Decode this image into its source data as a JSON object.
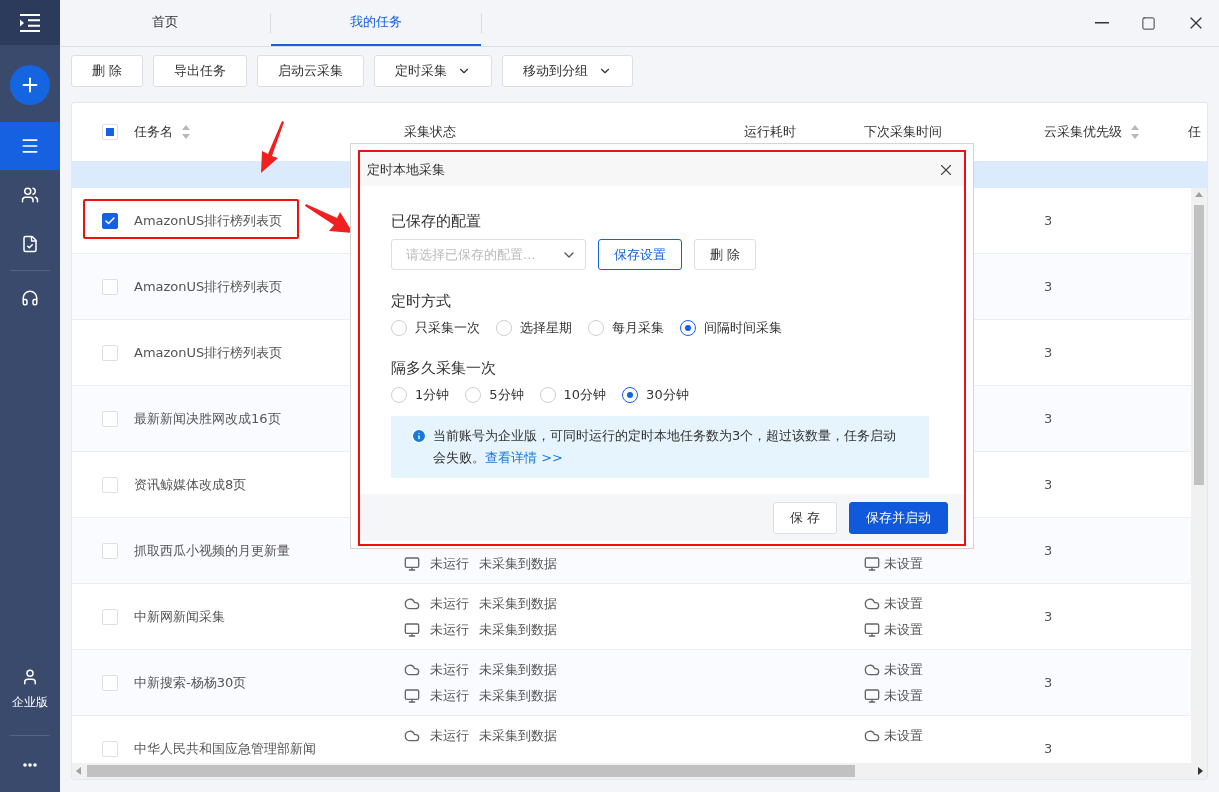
{
  "sidebar": {
    "items": [
      {
        "kind": "list",
        "selected": true
      },
      {
        "kind": "users",
        "selected": false
      },
      {
        "kind": "document",
        "selected": false
      },
      {
        "kind": "headset",
        "selected": false
      }
    ],
    "edition_label": "企业版"
  },
  "tabs": [
    {
      "label": "首页",
      "selected": false
    },
    {
      "label": "我的任务",
      "selected": true
    }
  ],
  "toolbar": [
    {
      "label": "删 除",
      "dropdown": false
    },
    {
      "label": "导出任务",
      "dropdown": false
    },
    {
      "label": "启动云采集",
      "dropdown": false
    },
    {
      "label": "定时采集",
      "dropdown": true
    },
    {
      "label": "移动到分组",
      "dropdown": true
    }
  ],
  "table": {
    "header_indeterminate": true,
    "columns": [
      {
        "label": "任务名",
        "sortable": true
      },
      {
        "label": "采集状态",
        "sortable": false
      },
      {
        "label": "运行耗时",
        "sortable": false
      },
      {
        "label": "下次采集时间",
        "sortable": false
      },
      {
        "label": "云采集优先级",
        "sortable": true
      },
      {
        "label": "任",
        "sortable": false
      }
    ],
    "rows": [
      {
        "name": "AmazonUS排行榜列表页",
        "checked": true,
        "status": [],
        "next_run": [],
        "priority": "3"
      },
      {
        "name": "AmazonUS排行榜列表页",
        "checked": false,
        "status": [],
        "next_run": [],
        "priority": "3"
      },
      {
        "name": "AmazonUS排行榜列表页",
        "checked": false,
        "status": [],
        "next_run": [],
        "priority": "3"
      },
      {
        "name": "最新新闻决胜网改成16页",
        "checked": false,
        "status": [],
        "next_run": [],
        "priority": "3"
      },
      {
        "name": "资讯鲸媒体改成8页",
        "checked": false,
        "status": [],
        "next_run": [],
        "priority": "3"
      },
      {
        "name": "抓取西瓜小视频的月更新量",
        "checked": false,
        "status": [
          {
            "kind": "monitor",
            "state": "未运行",
            "result": "未采集到数据"
          }
        ],
        "next_run": [
          {
            "kind": "monitor",
            "text": "未设置"
          }
        ],
        "priority": "3"
      },
      {
        "name": "中新网新闻采集",
        "checked": false,
        "status": [
          {
            "kind": "cloud",
            "state": "未运行",
            "result": "未采集到数据"
          },
          {
            "kind": "monitor",
            "state": "未运行",
            "result": "未采集到数据"
          }
        ],
        "next_run": [
          {
            "kind": "cloud",
            "text": "未设置"
          },
          {
            "kind": "monitor",
            "text": "未设置"
          }
        ],
        "priority": "3"
      },
      {
        "name": "中新搜索-杨杨30页",
        "checked": false,
        "status": [
          {
            "kind": "cloud",
            "state": "未运行",
            "result": "未采集到数据"
          },
          {
            "kind": "monitor",
            "state": "未运行",
            "result": "未采集到数据"
          }
        ],
        "next_run": [
          {
            "kind": "cloud",
            "text": "未设置"
          },
          {
            "kind": "monitor",
            "text": "未设置"
          }
        ],
        "priority": "3"
      },
      {
        "name": "中华人民共和国应急管理部新闻",
        "checked": false,
        "status": [
          {
            "kind": "cloud",
            "state": "未运行",
            "result": "未采集到数据"
          }
        ],
        "next_run": [
          {
            "kind": "cloud",
            "text": "未设置"
          }
        ],
        "priority": "3"
      }
    ]
  },
  "dialog": {
    "title": "定时本地采集",
    "saved_config": {
      "label": "已保存的配置",
      "placeholder": "请选择已保存的配置...",
      "buttons": [
        {
          "label": "保存设置",
          "kind": "outline"
        },
        {
          "label": "删 除",
          "kind": "default"
        }
      ]
    },
    "schedule": {
      "label": "定时方式",
      "options": [
        {
          "label": "只采集一次",
          "selected": false
        },
        {
          "label": "选择星期",
          "selected": false
        },
        {
          "label": "每月采集",
          "selected": false
        },
        {
          "label": "间隔时间采集",
          "selected": true
        }
      ]
    },
    "interval": {
      "label": "隔多久采集一次",
      "options": [
        {
          "label": "1分钟",
          "selected": false
        },
        {
          "label": "5分钟",
          "selected": false
        },
        {
          "label": "10分钟",
          "selected": false
        },
        {
          "label": "30分钟",
          "selected": true
        }
      ]
    },
    "notice": {
      "text": "当前账号为企业版，可同时运行的定时本地任务数为3个，超过该数量，任务启动会失败。",
      "link": "查看详情 >>"
    },
    "footer_buttons": [
      {
        "label": "保 存",
        "primary": false
      },
      {
        "label": "保存并启动",
        "primary": true
      }
    ]
  }
}
